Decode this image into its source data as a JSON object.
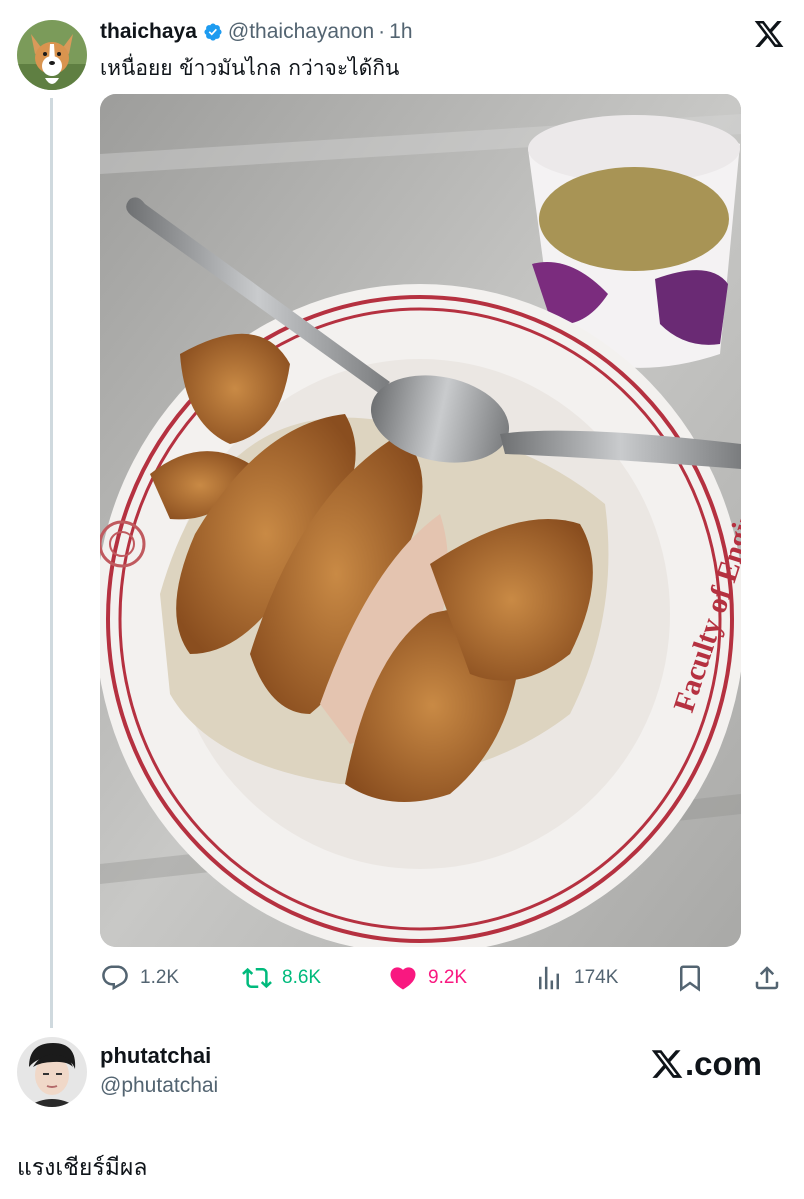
{
  "tweet": {
    "display_name": "thaichaya",
    "handle": "@thaichayanon",
    "separator": "·",
    "time": "1h",
    "verified": true,
    "text": "เหนื่อยย ข้าวมันไกล กว่าจะได้กิน",
    "photo": {
      "plate_text": "Faculty of Enginee"
    }
  },
  "actions": {
    "replies": "1.2K",
    "retweets": "8.6K",
    "likes": "9.2K",
    "views": "174K"
  },
  "quote_user": {
    "display_name": "phutatchai",
    "handle": "@phutatchai"
  },
  "watermark": {
    "text": ".com"
  },
  "caption": "แรงเชียร์มีผล",
  "colors": {
    "text": "#0f1419",
    "muted": "#536471",
    "retweet": "#00ba7c",
    "like": "#f91880",
    "verified": "#1d9bf0"
  },
  "icons": [
    "x-logo-icon",
    "verified-badge-icon",
    "reply-icon",
    "retweet-icon",
    "like-icon",
    "views-icon",
    "bookmark-icon",
    "share-icon"
  ]
}
